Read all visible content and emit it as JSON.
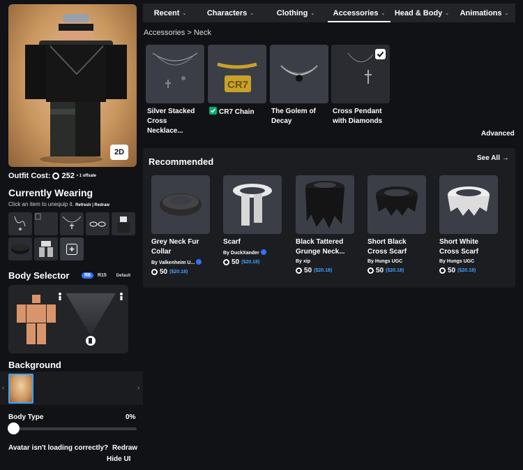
{
  "avatar": {
    "view_toggle": "2D"
  },
  "outfit_cost": {
    "label": "Outfit Cost:",
    "amount": "252",
    "offsale": "• 1 offsale"
  },
  "currently_wearing": {
    "title": "Currently Wearing",
    "subtitle": "Click an item to unequip it.",
    "links": "Refresh | Redraw",
    "add_label": "+"
  },
  "body_selector": {
    "title": "Body Selector",
    "options": [
      "R6",
      "R15"
    ],
    "selected": "R6",
    "default_label": "Default"
  },
  "background": {
    "title": "Background",
    "prev": "‹",
    "next": "›"
  },
  "body_type": {
    "label": "Body Type",
    "value": "0%",
    "level": 0
  },
  "footer": {
    "loading_msg": "Avatar isn't loading correctly?",
    "redraw": "Redraw",
    "hide_ui": "Hide UI"
  },
  "nav": {
    "tabs": [
      {
        "label": "Recent"
      },
      {
        "label": "Characters"
      },
      {
        "label": "Clothing"
      },
      {
        "label": "Accessories",
        "active": true
      },
      {
        "label": "Head & Body"
      },
      {
        "label": "Animations"
      }
    ]
  },
  "breadcrumb": {
    "parent": "Accessories",
    "separator": ">",
    "current": "Neck"
  },
  "items": [
    {
      "name_line1": "Silver Stacked",
      "name_line2": "Cross Necklace..."
    },
    {
      "name_line1": "CR7 Chain",
      "name_line2": "",
      "equipped_mark": true
    },
    {
      "name_line1": "The Golem of",
      "name_line2": "Decay"
    },
    {
      "name_line1": "Cross Pendant",
      "name_line2": "with Diamonds",
      "selected": true
    }
  ],
  "cr7_text": "CR7",
  "advanced_label": "Advanced",
  "recommended": {
    "title": "Recommended",
    "see_all": "See All →",
    "items": [
      {
        "name_line1": "Grey Neck Fur",
        "name_line2": "Collar",
        "by": "By",
        "creator": "Valkenheim U...",
        "verified": true,
        "price": "50",
        "usd": "($20.18)"
      },
      {
        "name_line1": "Scarf",
        "name_line2": "",
        "by": "By",
        "creator": "DuckXander",
        "verified": true,
        "price": "50",
        "usd": "($20.18)"
      },
      {
        "name_line1": "Black Tattered",
        "name_line2": "Grunge Neck...",
        "by": "By",
        "creator": "xip",
        "verified": false,
        "price": "50",
        "usd": "($20.18)"
      },
      {
        "name_line1": "Short Black",
        "name_line2": "Cross Scarf",
        "by": "By",
        "creator": "Hungs UGC",
        "verified": false,
        "price": "50",
        "usd": "($20.18)"
      },
      {
        "name_line1": "Short White",
        "name_line2": "Cross Scarf",
        "by": "By",
        "creator": "Hungs UGC",
        "verified": false,
        "price": "50",
        "usd": "($20.18)"
      }
    ]
  },
  "colors": {
    "accent_blue": "#3371ff",
    "price_blue": "#3ea2ff",
    "check_green": "#00b06f",
    "skin": "#d9956a"
  }
}
